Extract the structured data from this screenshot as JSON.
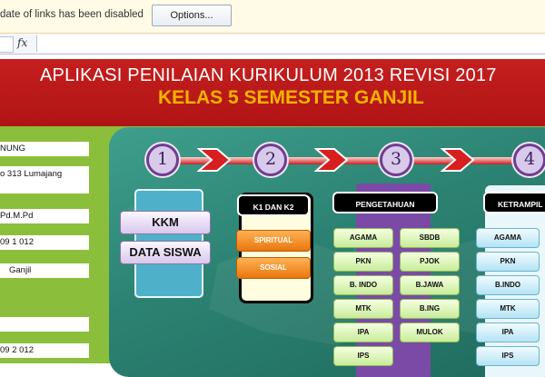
{
  "security_bar": {
    "message": "date of links has been disabled",
    "options_button": "Options..."
  },
  "formula_bar": {
    "fx_label": "fx",
    "value": ""
  },
  "banner": {
    "title": "APLIKASI PENILAIAN KURIKULUM 2013 REVISI 2017",
    "subtitle": "KELAS 5 SEMESTER GANJIL"
  },
  "left_panel": {
    "fields": [
      "NUNG",
      "o 313 Lumajang",
      "Pd.M.Pd",
      "09 1 012",
      "Ganjil",
      "",
      "09 2 012"
    ]
  },
  "steps": [
    "1",
    "2",
    "3",
    "4"
  ],
  "panel1": {
    "buttons": [
      "KKM",
      "DATA SISWA"
    ]
  },
  "panel2": {
    "title": "K1 DAN K2",
    "buttons": [
      "SPIRITUAL",
      "SOSIAL"
    ]
  },
  "panel3": {
    "title": "PENGETAHUAN",
    "left_col": [
      "AGAMA",
      "PKN",
      "B. INDO",
      "MTK",
      "IPA",
      "IPS"
    ],
    "right_col": [
      "SBDB",
      "PJOK",
      "B.JAWA",
      "B.ING",
      "MULOK"
    ]
  },
  "panel4": {
    "title": "KETRAMPIL",
    "col": [
      "AGAMA",
      "PKN",
      "B.INDO",
      "MTK",
      "IPA",
      "IPS"
    ]
  },
  "colors": {
    "banner_red": "#b81818",
    "subtitle_gold": "#f7b500",
    "frame_green": "#8bbf3b",
    "board_teal": "#2c8272"
  }
}
